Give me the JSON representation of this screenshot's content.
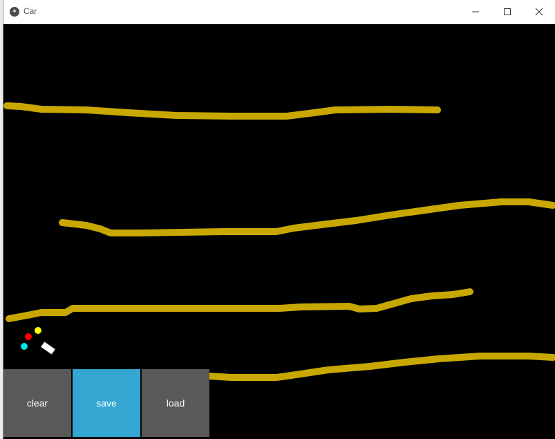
{
  "window": {
    "title": "Car",
    "icon": "kivy-icon"
  },
  "titlebar_buttons": [
    "minimize-icon",
    "maximize-icon",
    "close-icon"
  ],
  "colors": {
    "canvas_background": "#000000",
    "sand_line": "#c8a800",
    "car_body": "#ffffff",
    "sensor_1": "#00e5ee",
    "sensor_2": "#ff0000",
    "sensor_3": "#ffff00",
    "clear_button": "#595959",
    "save_button": "#33a6d1",
    "load_button": "#595959"
  },
  "buttons": {
    "clear_label": "clear",
    "save_label": "save",
    "load_label": "load"
  }
}
